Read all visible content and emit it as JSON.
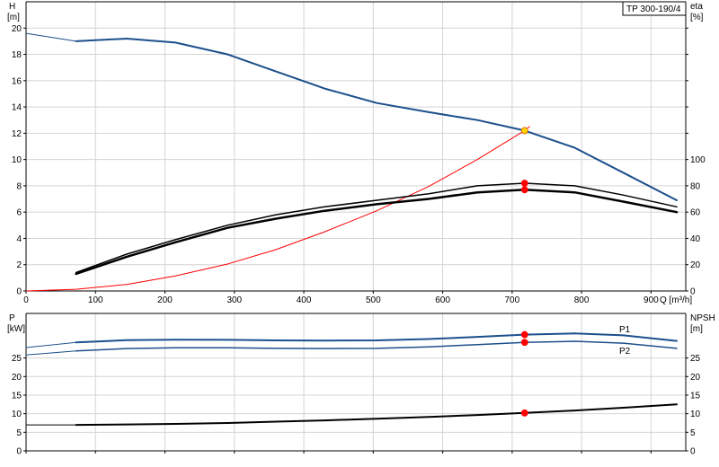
{
  "chart_data": [
    {
      "type": "line",
      "panel": "head-efficiency",
      "model_label": "TP 300-190/4",
      "xlabel": "Q [m³/h]",
      "ylabel_left_symbol": "H",
      "ylabel_left_unit": "[m]",
      "ylabel_right_symbol": "eta",
      "ylabel_right_unit": "[%]",
      "xlim": [
        0,
        950
      ],
      "ylim_left": [
        0,
        22
      ],
      "ylim_right": [
        0,
        220
      ],
      "x_ticks": [
        0,
        100,
        200,
        300,
        400,
        500,
        600,
        700,
        800,
        900
      ],
      "y_ticks_left": [
        0,
        2,
        4,
        6,
        8,
        10,
        12,
        14,
        16,
        18,
        20
      ],
      "y_ticks_right": [
        0,
        20,
        40,
        60,
        80,
        100
      ],
      "grid": true,
      "series": [
        {
          "key": "head_full",
          "axis": "left",
          "color": "#1c4f8c",
          "width": 2,
          "points": [
            [
              72,
              19.0
            ],
            [
              145,
              19.2
            ],
            [
              215,
              18.9
            ],
            [
              290,
              18.0
            ],
            [
              360,
              16.7
            ],
            [
              430,
              15.4
            ],
            [
              505,
              14.3
            ],
            [
              580,
              13.6
            ],
            [
              650,
              13.0
            ],
            [
              718,
              12.2
            ],
            [
              790,
              10.9
            ],
            [
              860,
              9.0
            ],
            [
              937,
              6.9
            ]
          ]
        },
        {
          "key": "head_partial",
          "axis": "left",
          "color": "#1c4f8c",
          "width": 1,
          "points": [
            [
              0,
              19.6
            ],
            [
              72,
              19.0
            ]
          ]
        },
        {
          "key": "system_curve",
          "axis": "left",
          "color": "#ff0000",
          "width": 1,
          "points": [
            [
              0,
              0
            ],
            [
              72,
              0.13
            ],
            [
              145,
              0.5
            ],
            [
              215,
              1.15
            ],
            [
              290,
              2.05
            ],
            [
              360,
              3.15
            ],
            [
              430,
              4.5
            ],
            [
              505,
              6.1
            ],
            [
              580,
              7.95
            ],
            [
              650,
              10.0
            ],
            [
              718,
              12.2
            ],
            [
              725,
              12.5
            ]
          ]
        },
        {
          "key": "eta_1",
          "axis": "right",
          "color": "#000000",
          "width": 2.5,
          "points": [
            [
              72,
              13
            ],
            [
              145,
              26
            ],
            [
              215,
              37
            ],
            [
              290,
              48
            ],
            [
              360,
              55
            ],
            [
              430,
              61
            ],
            [
              505,
              66
            ],
            [
              580,
              70
            ],
            [
              650,
              75
            ],
            [
              718,
              77
            ],
            [
              790,
              75
            ],
            [
              860,
              68
            ],
            [
              937,
              60
            ]
          ]
        },
        {
          "key": "eta_2",
          "axis": "right",
          "color": "#000000",
          "width": 1.5,
          "points": [
            [
              72,
              14
            ],
            [
              145,
              28
            ],
            [
              215,
              39
            ],
            [
              290,
              50
            ],
            [
              360,
              58
            ],
            [
              430,
              64
            ],
            [
              505,
              69
            ],
            [
              580,
              74
            ],
            [
              650,
              80
            ],
            [
              718,
              82
            ],
            [
              790,
              80
            ],
            [
              860,
              73
            ],
            [
              937,
              64
            ]
          ]
        }
      ],
      "markers": [
        {
          "axis": "left",
          "x": 718,
          "y": 12.2,
          "color": "#ffd500"
        },
        {
          "axis": "right",
          "x": 718,
          "y": 82,
          "color": "#ff0000"
        },
        {
          "axis": "right",
          "x": 718,
          "y": 77,
          "color": "#ff0000"
        }
      ]
    },
    {
      "type": "line",
      "panel": "power-npsh",
      "ylabel_left_symbol": "P",
      "ylabel_left_unit": "[kW]",
      "ylabel_right_symbol": "NPSH",
      "ylabel_right_unit": "[m]",
      "xlim": [
        0,
        950
      ],
      "ylim_left": [
        0,
        37
      ],
      "ylim_right": [
        0,
        37
      ],
      "y_ticks_left": [
        0,
        5,
        10,
        15,
        20,
        25
      ],
      "y_ticks_right": [
        0,
        5,
        10,
        15,
        20,
        25
      ],
      "grid": true,
      "series": [
        {
          "key": "P1",
          "name": "P1",
          "axis": "left",
          "color": "#1c4f8c",
          "width": 2,
          "points": [
            [
              72,
              29.2
            ],
            [
              145,
              29.8
            ],
            [
              215,
              29.95
            ],
            [
              290,
              29.9
            ],
            [
              360,
              29.75
            ],
            [
              430,
              29.7
            ],
            [
              505,
              29.75
            ],
            [
              580,
              30.1
            ],
            [
              650,
              30.7
            ],
            [
              718,
              31.3
            ],
            [
              790,
              31.6
            ],
            [
              860,
              31.1
            ],
            [
              937,
              29.6
            ]
          ]
        },
        {
          "key": "P2",
          "name": "P2",
          "axis": "left",
          "color": "#1c4f8c",
          "width": 1.5,
          "points": [
            [
              72,
              26.9
            ],
            [
              145,
              27.55
            ],
            [
              215,
              27.75
            ],
            [
              290,
              27.75
            ],
            [
              360,
              27.6
            ],
            [
              430,
              27.55
            ],
            [
              505,
              27.6
            ],
            [
              580,
              28.0
            ],
            [
              650,
              28.6
            ],
            [
              718,
              29.2
            ],
            [
              790,
              29.5
            ],
            [
              860,
              29.0
            ],
            [
              937,
              27.6
            ]
          ]
        },
        {
          "key": "P1_partial",
          "axis": "left",
          "color": "#1c4f8c",
          "width": 1,
          "points": [
            [
              0,
              27.8
            ],
            [
              72,
              29.2
            ]
          ]
        },
        {
          "key": "P2_partial",
          "axis": "left",
          "color": "#1c4f8c",
          "width": 1,
          "points": [
            [
              0,
              25.8
            ],
            [
              72,
              26.9
            ]
          ]
        },
        {
          "key": "npsh",
          "axis": "right",
          "color": "#000000",
          "width": 2,
          "points": [
            [
              72,
              7.0
            ],
            [
              145,
              7.1
            ],
            [
              215,
              7.25
            ],
            [
              290,
              7.5
            ],
            [
              360,
              7.85
            ],
            [
              430,
              8.2
            ],
            [
              505,
              8.65
            ],
            [
              580,
              9.15
            ],
            [
              650,
              9.65
            ],
            [
              718,
              10.2
            ],
            [
              790,
              10.85
            ],
            [
              860,
              11.6
            ],
            [
              937,
              12.5
            ]
          ]
        },
        {
          "key": "npsh_partial",
          "axis": "right",
          "color": "#000000",
          "width": 1,
          "points": [
            [
              0,
              7.0
            ],
            [
              72,
              7.0
            ]
          ]
        }
      ],
      "markers": [
        {
          "axis": "left",
          "x": 718,
          "y": 31.3,
          "color": "#ff0000"
        },
        {
          "axis": "left",
          "x": 718,
          "y": 29.2,
          "color": "#ff0000"
        },
        {
          "axis": "right",
          "x": 718,
          "y": 10.2,
          "color": "#ff0000"
        }
      ]
    }
  ]
}
